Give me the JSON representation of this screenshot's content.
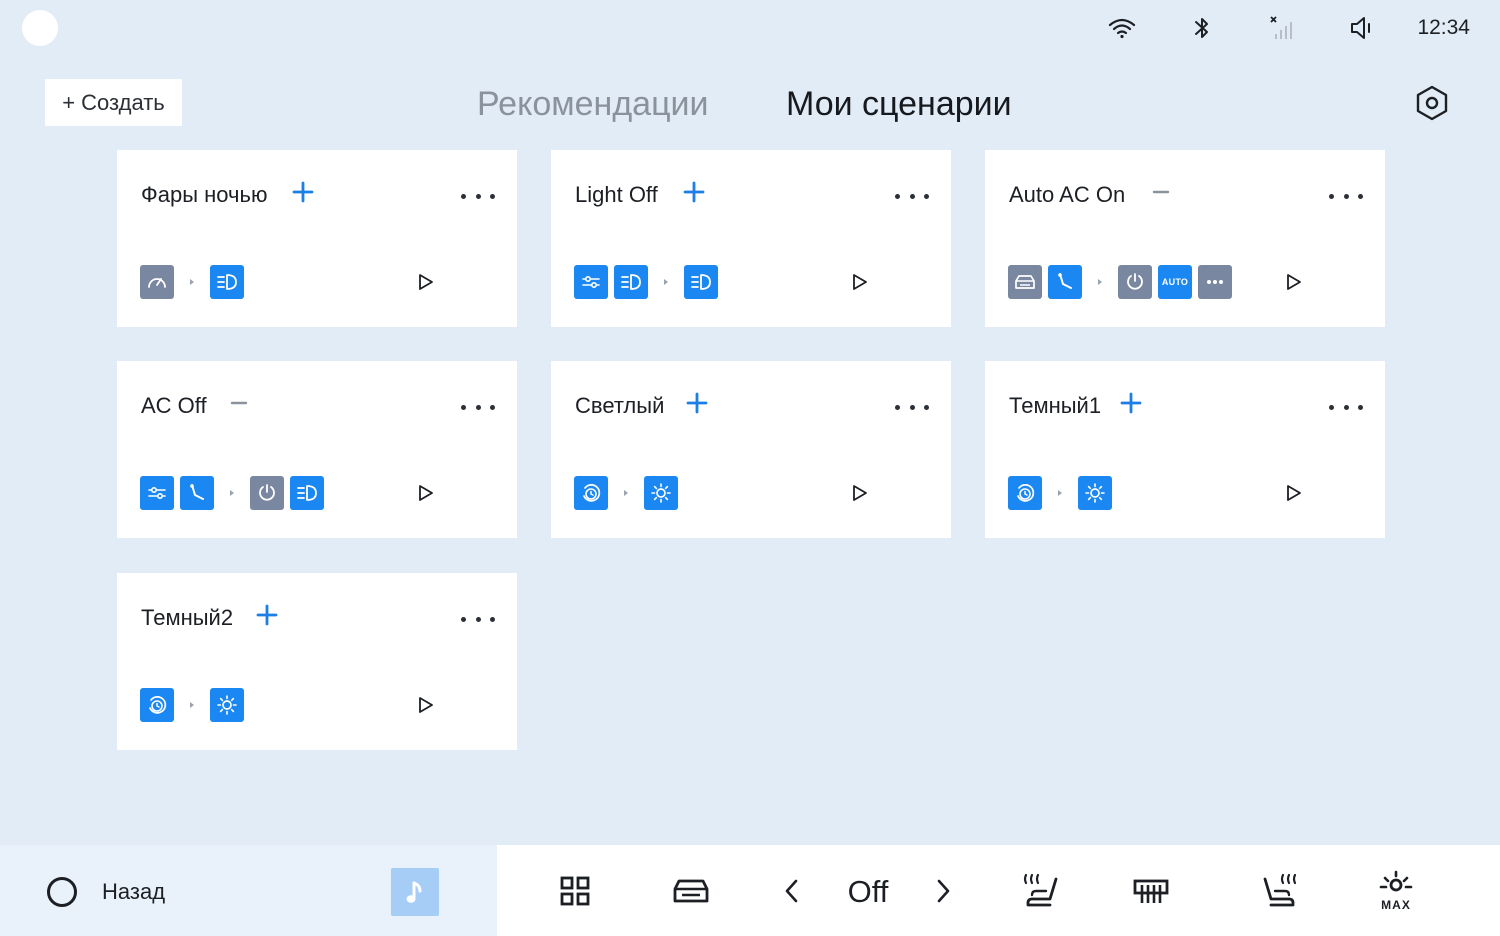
{
  "status_bar": {
    "time": "12:34",
    "icons": [
      "wifi-icon",
      "bluetooth-icon",
      "signal-icon",
      "volume-icon"
    ]
  },
  "header": {
    "create_label": "+ Создать",
    "tabs": [
      {
        "label": "Рекомендации",
        "active": false
      },
      {
        "label": "Мои сценарии",
        "active": true
      }
    ]
  },
  "cards": [
    {
      "title": "Фары ночью",
      "toggle": "+",
      "conditions": [
        "speedometer-icon"
      ],
      "actions": [
        "headlight-icon"
      ]
    },
    {
      "title": "Light Off",
      "toggle": "+",
      "conditions": [
        "sliders-icon",
        "headlight-icon"
      ],
      "actions": [
        "headlight-icon"
      ]
    },
    {
      "title": "Auto AC On",
      "toggle": "−",
      "conditions": [
        "car-icon",
        "seat-icon"
      ],
      "actions": [
        "power-icon",
        "auto-icon",
        "more-icon"
      ]
    },
    {
      "title": "AC Off",
      "toggle": "−",
      "conditions": [
        "sliders-icon",
        "seat-icon"
      ],
      "actions": [
        "power-icon",
        "headlight-icon"
      ]
    },
    {
      "title": "Светлый",
      "toggle": "+",
      "conditions": [
        "clock-icon"
      ],
      "actions": [
        "sun-icon"
      ]
    },
    {
      "title": "Темный1",
      "toggle": "+",
      "conditions": [
        "clock-icon"
      ],
      "actions": [
        "sun-icon"
      ]
    },
    {
      "title": "Темный2",
      "toggle": "+",
      "conditions": [
        "clock-icon"
      ],
      "actions": [
        "sun-icon"
      ]
    }
  ],
  "chip_auto_label": "AUTO",
  "bottom_bar": {
    "back_label": "Назад",
    "fan_value": "Off"
  },
  "colors": {
    "background": "#e2ecf6",
    "accent": "#1b87f2",
    "chip_gray": "#7a87a0",
    "music_button": "#a6cdf5"
  }
}
